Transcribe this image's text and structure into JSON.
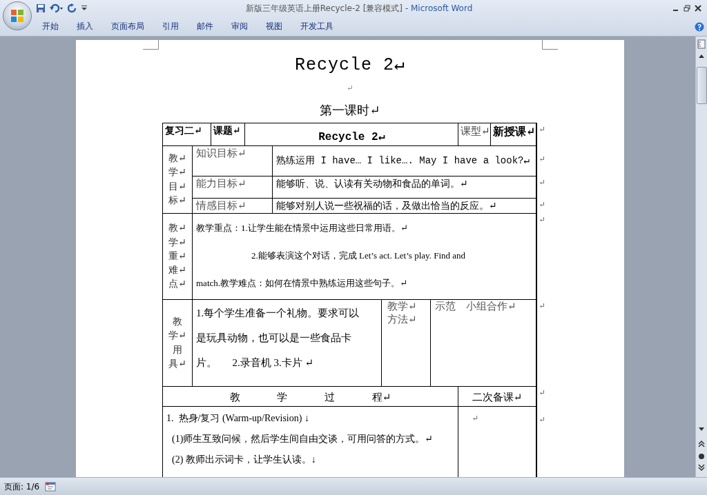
{
  "window": {
    "title": "新版三年级英语上册Recycle-2 [兼容模式]",
    "app": "- Microsoft Word"
  },
  "ribbon_tabs": [
    {
      "label": "开始"
    },
    {
      "label": "插入"
    },
    {
      "label": "页面布局"
    },
    {
      "label": "引用"
    },
    {
      "label": "邮件"
    },
    {
      "label": "审阅"
    },
    {
      "label": "视图"
    },
    {
      "label": "开发工具"
    }
  ],
  "document": {
    "title": "Recycle 2↵",
    "blank_mark": "↵",
    "subtitle": "第一课时↵",
    "table": {
      "header": {
        "cells": [
          "复习二↵",
          "课题↵",
          "Recycle 2↵",
          "课型↵",
          "新授课↵"
        ],
        "end_mark": "↵"
      },
      "goals": {
        "side": [
          "教↵",
          "学↵",
          "目↵",
          "标↵"
        ],
        "rows": [
          {
            "label": "知识目标↵",
            "content": "熟练运用 I have… I like…. May I have a look?↵",
            "end_mark": "↵"
          },
          {
            "label": "能力目标↵",
            "content": "能够听、说、认读有关动物和食品的单词。↵",
            "end_mark": "↵"
          },
          {
            "label": "情感目标↵",
            "content": "能够对别人说一些祝福的话，及做出恰当的反应。↵",
            "end_mark": "↵"
          }
        ]
      },
      "key_points": {
        "side": [
          "教↵",
          "学↵",
          "重↵",
          "难↵",
          "点↵"
        ],
        "lines": [
          "教学重点：1.让学生能在情景中运用这些日常用语。↵",
          "2.能够表演这个对话，完成 Let’s act. Let’s play. Find and",
          "match.教学难点：如何在情景中熟练运用这些句子。↵"
        ],
        "end_mark": "↵"
      },
      "tools": {
        "side": [
          "教",
          "学↵",
          "用",
          "具↵"
        ],
        "lines": [
          "1.每个学生准备一个礼物。要求可以",
          "是玩具动物，也可以是一些食品卡",
          "片。      2.录音机 3.卡片 ↵"
        ],
        "method_label": "教学↵\n方法↵",
        "method": "示范    小组合作↵",
        "end_mark": "↵"
      },
      "process_header": {
        "title": "教 学 过 程↵",
        "second": "二次备课↵",
        "end_mark": "↵"
      },
      "process": {
        "lines": [
          "1.  热身/复习 (Warm-up/Revision) ↓",
          "(1)师生互致问候，然后学生间自由交谈，可用问答的方式。↵",
          "(2) 教师出示词卡，让学生认读。↓"
        ],
        "second": "↵",
        "end_mark": "↵"
      }
    }
  },
  "status_bar": {
    "page": "页面: 1/6"
  }
}
